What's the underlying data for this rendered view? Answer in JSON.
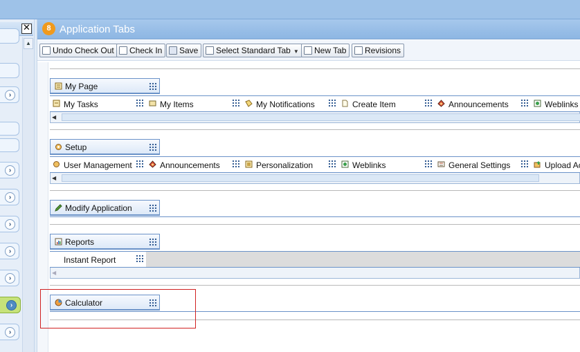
{
  "window": {
    "close_glyph": "✕"
  },
  "main": {
    "badge": "8",
    "title": "Application Tabs"
  },
  "toolbar": {
    "undo_checkout": "Undo Check Out",
    "check_in": "Check In",
    "save": "Save",
    "select_standard_tab": "Select Standard Tab",
    "new_tab": "New Tab",
    "revisions": "Revisions"
  },
  "groups": {
    "my_page": {
      "label": "My Page",
      "items": [
        "My Tasks",
        "My Items",
        "My Notifications",
        "Create Item",
        "Announcements",
        "Weblinks"
      ]
    },
    "setup": {
      "label": "Setup",
      "items": [
        "User Management",
        "Announcements",
        "Personalization",
        "Weblinks",
        "General Settings",
        "Upload Ac"
      ]
    },
    "modify_application": {
      "label": "Modify Application"
    },
    "reports": {
      "label": "Reports",
      "items": [
        "Instant Report"
      ]
    },
    "calculator": {
      "label": "Calculator"
    }
  },
  "colors": {
    "accent": "#8db6e3",
    "badge": "#f09a1d",
    "selection": "#d02020",
    "active_side": "#c6e27a"
  }
}
